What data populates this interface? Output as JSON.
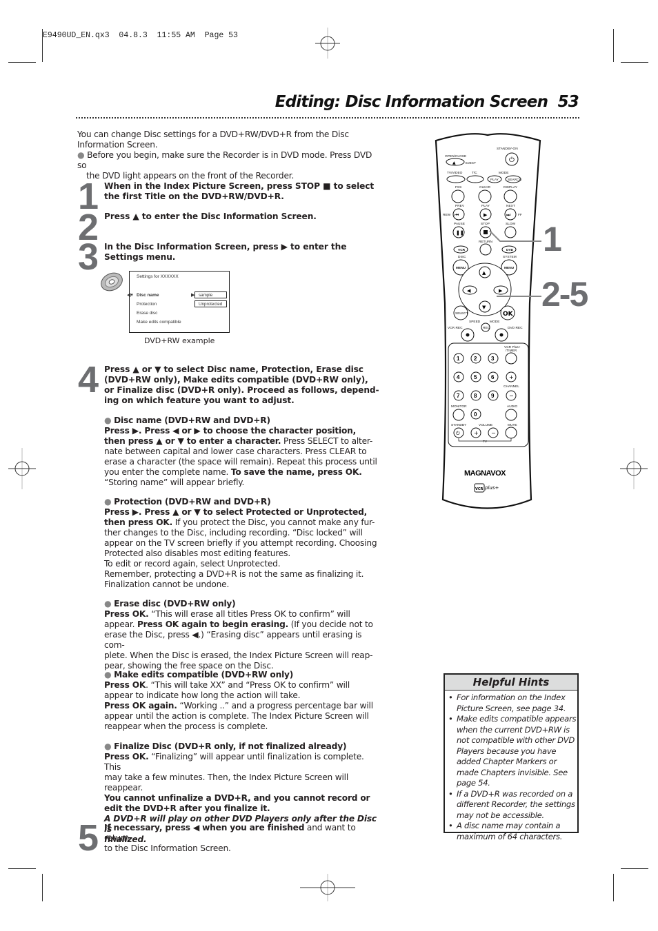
{
  "slug": "E9490UD_EN.qx3  04.8.3  11:55 AM  Page 53",
  "header": {
    "title": "Editing: Disc Information Screen",
    "page_number": "53"
  },
  "intro": {
    "line1": "You can change Disc settings for a DVD+RW/DVD+R from the Disc",
    "line2": "Information Screen.",
    "bullet1": "Before you begin, make sure the Recorder is in DVD mode. Press DVD so",
    "bullet2": "the DVD light appears on the front of the Recorder."
  },
  "steps": [
    {
      "number": "1",
      "lines": [
        "When in the Index Picture Screen, press STOP ■ to select",
        "the first Title on the DVD+RW/DVD+R."
      ]
    },
    {
      "number": "2",
      "lines": [
        "Press ▲ to enter the Disc Information Screen."
      ]
    },
    {
      "number": "3",
      "lines": [
        "In the Disc Information Screen, press ▶ to enter the",
        "Settings menu."
      ]
    },
    {
      "number": "4",
      "lines": [
        "Press ▲ or ▼ to select Disc name, Protection, Erase disc",
        "(DVD+RW only), Make edits compatible (DVD+RW only),",
        "or Finalize disc (DVD+R only). Proceed as follows, depend-",
        "ing on which feature you want to adjust."
      ]
    },
    {
      "number": "5",
      "bold": "If necessary, press ◀ when you are finished",
      "rest": " and want to return",
      "line2": "to the Disc Information Screen."
    }
  ],
  "osd": {
    "heading": "Settings for XXXXXX",
    "items": [
      "Disc name",
      "Protection",
      "Erase disc",
      "Make edits compatible"
    ],
    "values": [
      "sample",
      "Unprotected"
    ],
    "caption": "DVD+RW example"
  },
  "sections": {
    "disc_name": {
      "heading": "Disc name  (DVD+RW and DVD+R)",
      "b1": "Press ▶. Press ◀ or ▶ to choose the character position,",
      "b2": "then press ▲ or ▼ to enter a character.",
      "t2": " Press SELECT to alter-",
      "t3": "nate between capital and lower case characters. Press CLEAR to",
      "t4": "erase a character (the space will remain). Repeat this process until",
      "t5a": "you enter the complete name. ",
      "b5": "To save the name, press OK.",
      "t6": "“Storing name” will appear briefly."
    },
    "protection": {
      "heading": "Protection  (DVD+RW and DVD+R)",
      "b1": "Press ▶. Press ▲ or ▼ to select Protected or Unprotected,",
      "b2": "then press OK.",
      "t2": " If you protect the Disc, you cannot make any fur-",
      "t3": "ther changes to the Disc, including recording. “Disc locked” will",
      "t4": "appear on the TV screen briefly if you attempt recording. Choosing",
      "t5": "Protected also disables most editing features.",
      "t6": "To edit or record again, select Unprotected.",
      "t7": "Remember, protecting a DVD+R is not the same as finalizing it.",
      "t8": "Finalization cannot be undone."
    },
    "erase": {
      "heading": "Erase disc  (DVD+RW only)",
      "b1": "Press OK.",
      "t1": " “This will erase all titles Press OK to confirm” will",
      "t2a": "appear. ",
      "b2": "Press OK again to begin erasing.",
      "t2b": " (If you decide not to",
      "t3": "erase the Disc, press ◀.) “Erasing disc” appears until erasing is com-",
      "t4": "plete. When the Disc is erased, the Index Picture Screen will reap-",
      "t5": "pear, showing the free space on the Disc."
    },
    "compatible": {
      "heading": "Make edits compatible  (DVD+RW only)",
      "b1": "Press OK",
      "t1": ". “This will take XX” and “Press OK to confirm” will",
      "t2": "appear to indicate how long the action will take.",
      "b3": "Press OK again.",
      "t3": " “Working ..” and a progress percentage bar will",
      "t4": "appear until the action is complete. The Index Picture Screen will",
      "t5": "reappear when the process is complete."
    },
    "finalize": {
      "heading": "Finalize Disc (DVD+R only, if not finalized already)",
      "b1": "Press OK.",
      "t1": " “Finalizing” will appear until finalization is complete. This",
      "t2": "may take a few minutes. Then, the Index Picture Screen will reappear.",
      "b3": "You cannot unfinalize a DVD+R, and you cannot record or",
      "b4": "edit the DVD+R after you finalize it.",
      "i5": "A DVD+R will play on other DVD Players only after the Disc is",
      "i6": "finalized."
    }
  },
  "remote": {
    "brand": "MAGNAVOX",
    "logo": "VCR Plus+",
    "labels": {
      "standby_on": "STANDBY-ON",
      "open_close": "OPEN/CLOSE",
      "eject": "EJECT",
      "tv_video": "TV/VIDEO",
      "tc": "T/C",
      "mode": "MODE",
      "play_small": "PLAY",
      "search": "SEARCH",
      "fss": "FSS",
      "clear": "CLEAR",
      "display": "DISPLAY",
      "prev": "PREV",
      "play": "PLAY",
      "next": "NEXT",
      "rew": "REW",
      "ff": "FF",
      "pause": "PAUSE",
      "stop": "STOP",
      "slow": "SLOW",
      "return": "RETURN",
      "vcr": "VCR",
      "dvd": "DVD",
      "disc": "DISC",
      "system": "SYSTEM",
      "menu": "MENU",
      "select": "SELECT",
      "ok": "OK",
      "speed": "SPEED",
      "rec": "REC",
      "vcr_rec": "VCR REC",
      "dvd_rec": "DVD REC",
      "vcrplus_timer": "VCR Plus+ /TIMER",
      "channel": "CHANNEL",
      "monitor": "MONITOR",
      "audio": "AUDIO",
      "standby": "STANDBY",
      "volume": "VOLUME",
      "mute": "MUTE",
      "tv": "TV"
    },
    "digits": [
      "1",
      "2",
      "3",
      "4",
      "5",
      "6",
      "7",
      "8",
      "9",
      "0"
    ],
    "callouts": [
      "1",
      "2-5"
    ]
  },
  "hints": {
    "title": "Helpful Hints",
    "items": [
      "For information on the Index Picture Screen, see page 34.",
      "Make edits compatible appears when the current DVD+RW is not compatible with other DVD Players because you have added Chapter Markers  or made Chapters invisible. See page 54.",
      "If a DVD+R was recorded on a different Recorder, the settings may not be accessible.",
      "A disc name may contain a maximum of 64 characters."
    ]
  }
}
